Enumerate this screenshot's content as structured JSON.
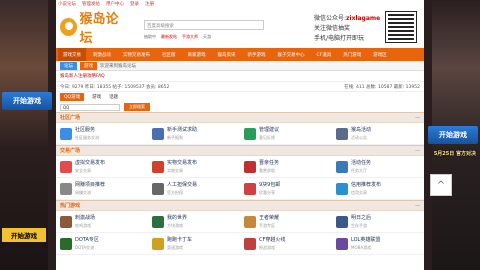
{
  "topbar": {
    "links": [
      "小说论坛",
      "管理发帖",
      "用户中心",
      "登录",
      "注册"
    ]
  },
  "header": {
    "logo": "猴岛论坛",
    "search_placeholder": "百度高级搜索",
    "hot": [
      "抽取中",
      "最新发帖",
      "手游大师",
      "天游"
    ],
    "wechat": "微信公众号:",
    "wechat_id": "zixlagame",
    "follow": "关注微信抽奖",
    "mobile": "手机/电脑打开即玩"
  },
  "nav": [
    "游戏交易",
    "刺激战场",
    "实物交易发布",
    "社区版",
    "商家游戏",
    "猴岛资讯",
    "新手游戏",
    "猴子交易中心",
    "CF道具",
    "热门游戏",
    "游戏区"
  ],
  "sub": {
    "tags": [
      "论坛",
      "游戏"
    ],
    "notice": "欢迎来到猴岛论坛"
  },
  "mark": "猴岛新人注册攻略FAQ",
  "stats": {
    "left": "今日: 9279 昨日: 18355 帖子: 1509537 会员: 8652",
    "right": "在线: 411  总数: 10587  最新: 13952"
  },
  "tabs": [
    "QQ游戏",
    "游戏",
    "话题"
  ],
  "search": {
    "value": "QQ",
    "button": "立即搜索"
  },
  "sections": [
    {
      "title": "社区广场",
      "rows": [
        [
          {
            "n": "社区服务",
            "d": "社区服务交流"
          },
          {
            "n": "新手测试求助",
            "d": "新手报到"
          },
          {
            "n": "管理建议",
            "d": "意见反馈"
          },
          {
            "n": "猴岛活动",
            "d": "活动公告"
          }
        ]
      ]
    },
    {
      "title": "交易广场",
      "rows": [
        [
          {
            "n": "虚拟交易发布",
            "d": "安全交易"
          },
          {
            "n": "实物交易发布",
            "d": "实物交易"
          },
          {
            "n": "晋亲任务",
            "d": "悬赏求助"
          },
          {
            "n": "活动任务",
            "d": "任务大厅"
          }
        ],
        [
          {
            "n": "网赚项目推荐",
            "d": "网赚交流"
          },
          {
            "n": "人工担保交易",
            "d": "官方担保"
          },
          {
            "n": "9块9包邮",
            "d": "优惠分享"
          },
          {
            "n": "信用推荐发布",
            "d": "信用交易"
          }
        ]
      ]
    },
    {
      "title": "热门游戏",
      "rows": [
        [
          {
            "n": "刺激战场",
            "d": "吃鸡游戏"
          },
          {
            "n": "我的世界",
            "d": "方块游戏"
          },
          {
            "n": "王者荣耀",
            "d": "手游专区"
          },
          {
            "n": "明日之后",
            "d": "生存手游"
          }
        ],
        [
          {
            "n": "DOTA专区",
            "d": "DOTA交流"
          },
          {
            "n": "跑跑卡丁车",
            "d": "竞速游戏"
          },
          {
            "n": "CF穿越火线",
            "d": "枪战游戏"
          },
          {
            "n": "LOL英雄联盟",
            "d": "MOBA游戏"
          }
        ]
      ]
    }
  ],
  "side": {
    "left_ad": "开始游戏",
    "right_ad": "开始游戏",
    "date": "5月25日 官方对决",
    "badge": "开始游戏"
  },
  "scroll_top": "^",
  "colors": {
    "accent": "#e8650e"
  }
}
